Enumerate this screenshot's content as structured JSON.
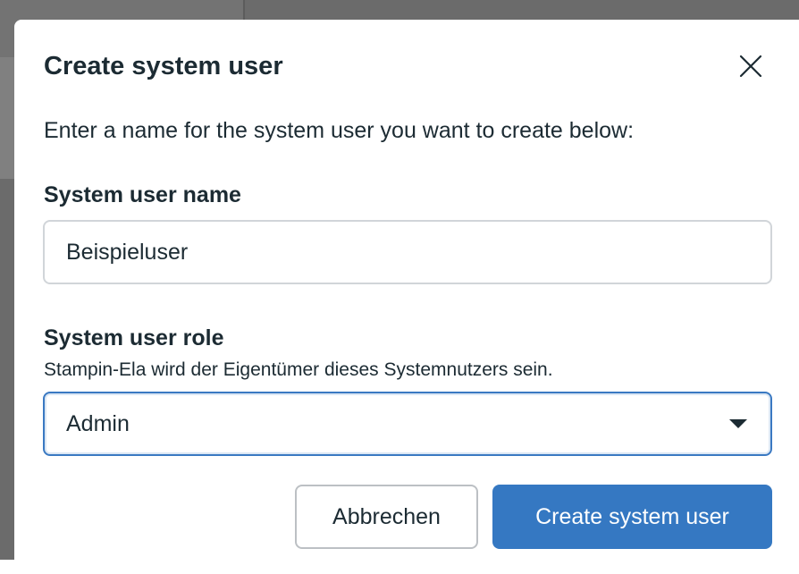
{
  "dialog": {
    "title": "Create system user",
    "close_icon": "close-icon",
    "intro": "Enter a name for the system user you want to create below:",
    "name_field": {
      "label": "System user name",
      "value": "Beispieluser"
    },
    "role_field": {
      "label": "System user role",
      "help": "Stampin-Ela wird der Eigentümer dieses Systemnutzers sein.",
      "selected": "Admin",
      "caret_icon": "caret-down-icon"
    },
    "buttons": {
      "cancel": "Abbrechen",
      "create": "Create system user"
    }
  },
  "colors": {
    "primary": "#3578c2",
    "focus_border": "#3a79c2",
    "text": "#1c2b33",
    "overlay": "#6b6b6b"
  }
}
